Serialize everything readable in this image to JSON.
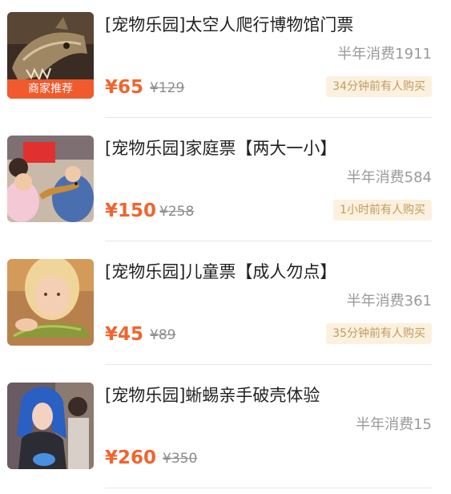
{
  "currency": "¥",
  "accent_color": "#f0652f",
  "items": [
    {
      "title": "[宠物乐园]太空人爬行博物馆门票",
      "sales": "半年消费1911",
      "price": "¥65",
      "original_price": "¥129",
      "recent": "34分钟前有人购买",
      "badge": "商家推荐",
      "image": "dinosaur-skull"
    },
    {
      "title": "[宠物乐园]家庭票【两大一小】",
      "sales": "半年消费584",
      "price": "¥150",
      "original_price": "¥258",
      "recent": "1小时前有人购买",
      "image": "children-with-reptile"
    },
    {
      "title": "[宠物乐园]儿童票【成人勿点】",
      "sales": "半年消费361",
      "price": "¥45",
      "original_price": "¥89",
      "recent": "35分钟前有人购买",
      "image": "girl-with-lizard"
    },
    {
      "title": "[宠物乐园]蜥蜴亲手破壳体验",
      "sales": "半年消费15",
      "price": "¥260",
      "original_price": "¥350",
      "image": "woman-blue-hair"
    }
  ]
}
